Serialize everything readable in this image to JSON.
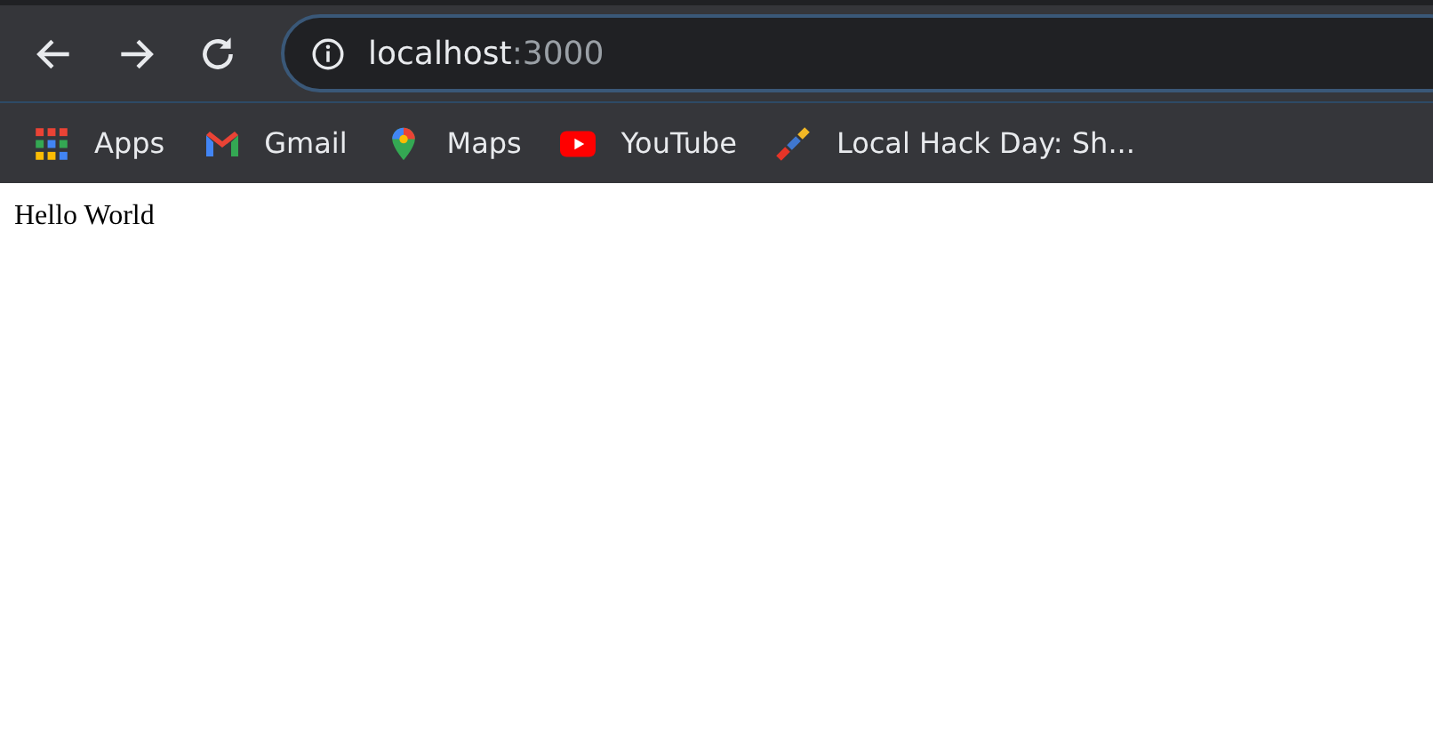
{
  "toolbar": {
    "address": {
      "host": "localhost",
      "port": ":3000"
    }
  },
  "bookmarks": [
    {
      "kind": "apps",
      "label": "Apps"
    },
    {
      "kind": "gmail",
      "label": "Gmail"
    },
    {
      "kind": "maps",
      "label": "Maps"
    },
    {
      "kind": "youtube",
      "label": "YouTube"
    },
    {
      "kind": "mlh",
      "label": "Local Hack Day: Sh..."
    }
  ],
  "page": {
    "text": "Hello World"
  }
}
